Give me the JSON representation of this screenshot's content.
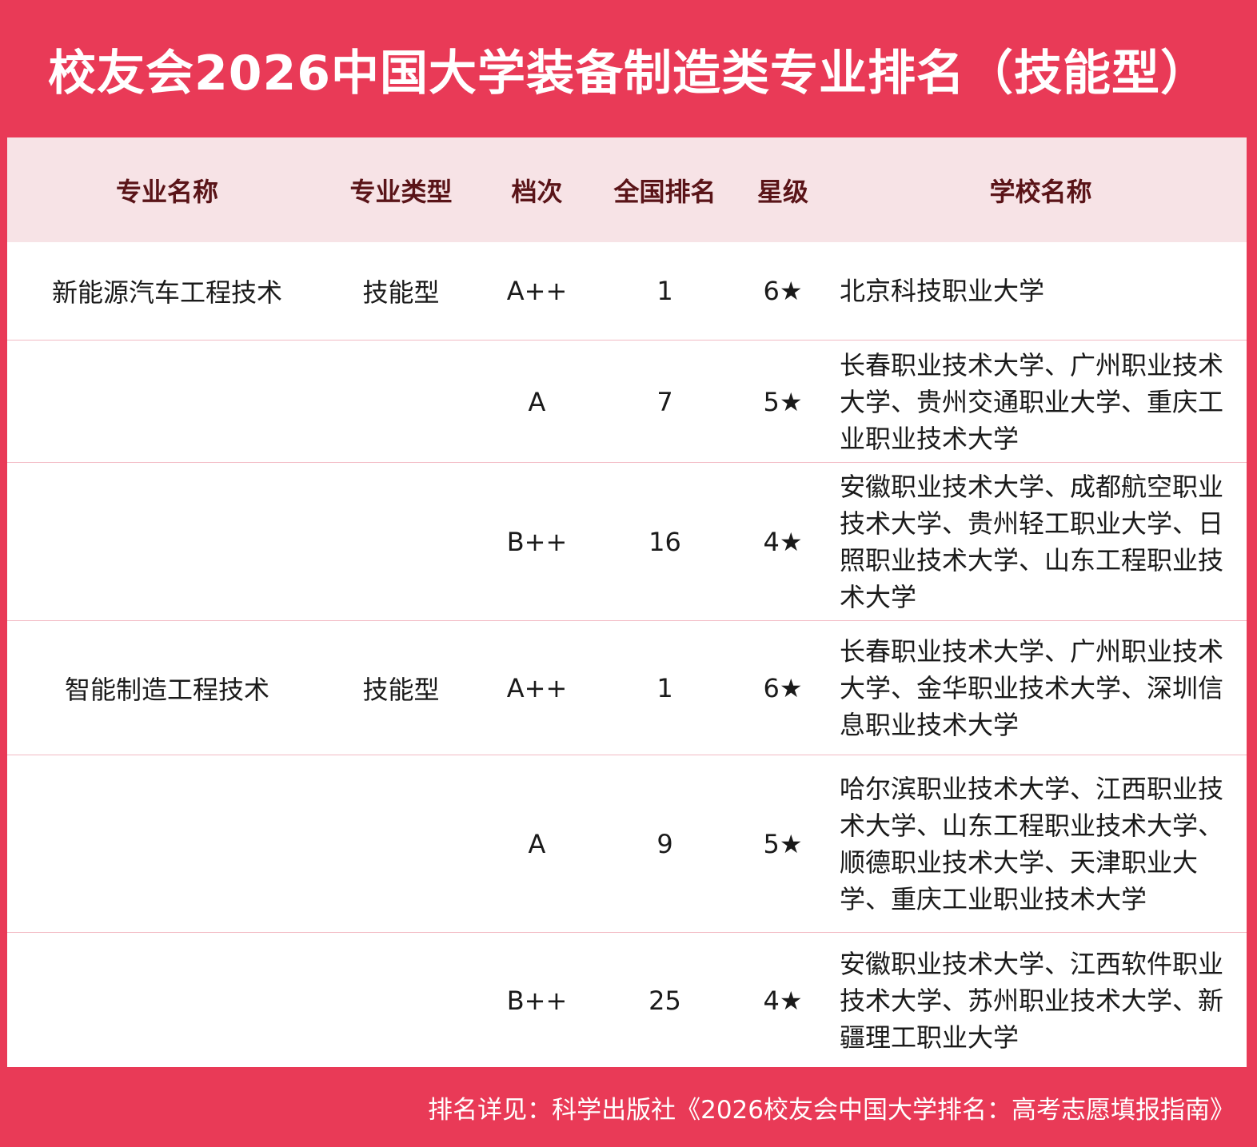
{
  "title": "校友会2026中国大学装备制造类专业排名（技能型）",
  "headers": {
    "major": "专业名称",
    "type": "专业类型",
    "level": "档次",
    "rank": "全国排名",
    "stars": "星级",
    "school": "学校名称"
  },
  "rows": [
    {
      "major": "新能源汽车工程技术",
      "type": "技能型",
      "level": "A++",
      "rank": "1",
      "stars": "6★",
      "school": "北京科技职业大学"
    },
    {
      "major": "",
      "type": "",
      "level": "A",
      "rank": "7",
      "stars": "5★",
      "school": "长春职业技术大学、广州职业技术大学、贵州交通职业大学、重庆工业职业技术大学"
    },
    {
      "major": "",
      "type": "",
      "level": "B++",
      "rank": "16",
      "stars": "4★",
      "school": "安徽职业技术大学、成都航空职业技术大学、贵州轻工职业大学、日照职业技术大学、山东工程职业技术大学"
    },
    {
      "major": "智能制造工程技术",
      "type": "技能型",
      "level": "A++",
      "rank": "1",
      "stars": "6★",
      "school": "长春职业技术大学、广州职业技术大学、金华职业技术大学、深圳信息职业技术大学"
    },
    {
      "major": "",
      "type": "",
      "level": "A",
      "rank": "9",
      "stars": "5★",
      "school": "哈尔滨职业技术大学、江西职业技术大学、山东工程职业技术大学、顺德职业技术大学、天津职业大学、重庆工业职业技术大学"
    },
    {
      "major": "",
      "type": "",
      "level": "B++",
      "rank": "25",
      "stars": "4★",
      "school": "安徽职业技术大学、江西软件职业技术大学、苏州职业技术大学、新疆理工职业大学"
    }
  ],
  "footer": "排名详见：科学出版社《2026校友会中国大学排名：高考志愿填报指南》",
  "colors": {
    "brand": "#e93a57",
    "header_bg": "#f7e3e6",
    "header_text": "#5a1418"
  }
}
